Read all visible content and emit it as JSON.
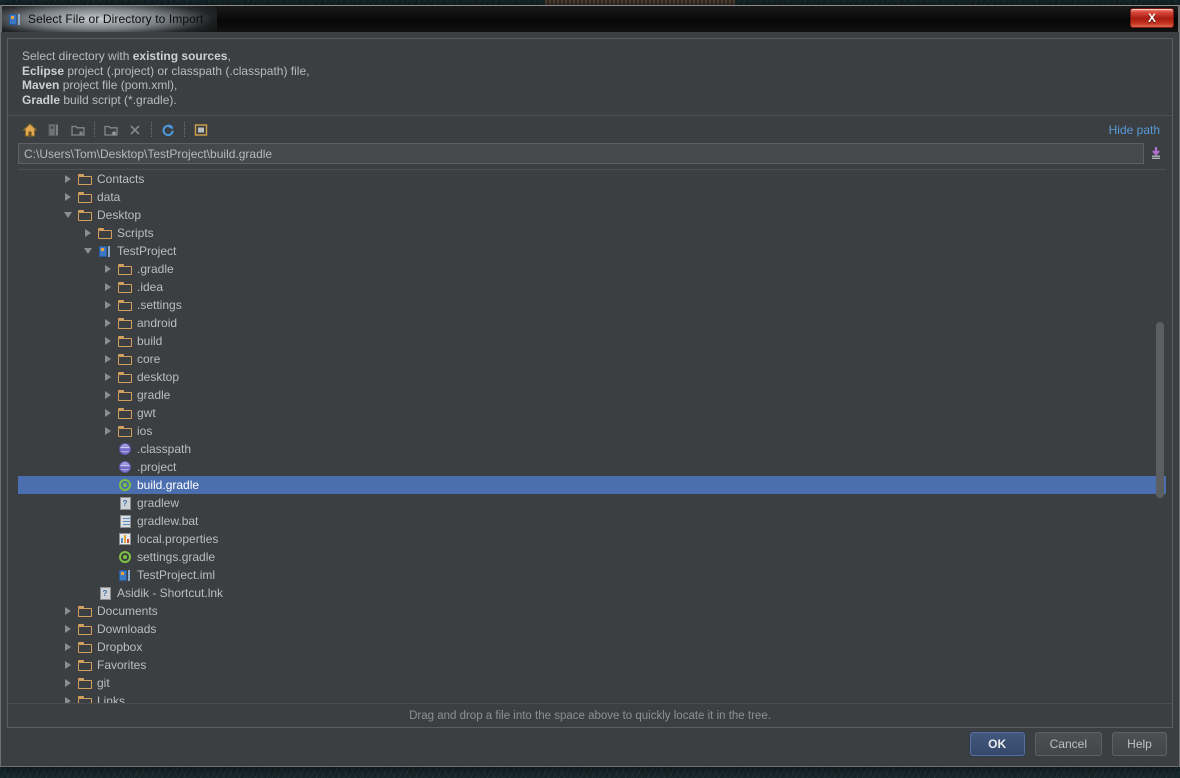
{
  "window": {
    "title": "Select File or Directory to Import",
    "app_icon": "intellij-idea-icon",
    "close_label": "X"
  },
  "description": {
    "line1_prefix": "Select directory with ",
    "line1_bold": "existing sources",
    "line1_suffix": ",",
    "line2_bold": "Eclipse",
    "line2_rest": " project (.project) or classpath (.classpath) file,",
    "line3_bold": "Maven",
    "line3_rest": " project file (pom.xml),",
    "line4_bold": "Gradle",
    "line4_rest": " build script (*.gradle)."
  },
  "toolbar": {
    "buttons": [
      {
        "name": "home-icon",
        "title": "Home"
      },
      {
        "name": "project-dir-icon",
        "title": "Project Directory"
      },
      {
        "name": "desktop-folder-icon",
        "title": "Desktop"
      },
      {
        "name": "new-folder-icon",
        "title": "New Folder"
      },
      {
        "name": "delete-icon",
        "title": "Delete"
      },
      {
        "name": "refresh-icon",
        "title": "Refresh"
      },
      {
        "name": "show-hidden-files-icon",
        "title": "Show Hidden Files and Directories"
      }
    ],
    "hide_path_label": "Hide path"
  },
  "path": {
    "value": "C:\\Users\\Tom\\Desktop\\TestProject\\build.gradle",
    "placeholder": "",
    "dropdown_icon": "path-history-dropdown-icon"
  },
  "tree": {
    "rows": [
      {
        "label": "Contacts",
        "indent": 1,
        "twisty": "collapsed",
        "icon": "folder"
      },
      {
        "label": "data",
        "indent": 1,
        "twisty": "collapsed",
        "icon": "folder"
      },
      {
        "label": "Desktop",
        "indent": 1,
        "twisty": "expanded",
        "icon": "folder"
      },
      {
        "label": "Scripts",
        "indent": 2,
        "twisty": "collapsed",
        "icon": "folder"
      },
      {
        "label": "TestProject",
        "indent": 2,
        "twisty": "expanded",
        "icon": "module"
      },
      {
        "label": ".gradle",
        "indent": 3,
        "twisty": "collapsed",
        "icon": "folder"
      },
      {
        "label": ".idea",
        "indent": 3,
        "twisty": "collapsed",
        "icon": "folder"
      },
      {
        "label": ".settings",
        "indent": 3,
        "twisty": "collapsed",
        "icon": "folder"
      },
      {
        "label": "android",
        "indent": 3,
        "twisty": "collapsed",
        "icon": "folder"
      },
      {
        "label": "build",
        "indent": 3,
        "twisty": "collapsed",
        "icon": "folder"
      },
      {
        "label": "core",
        "indent": 3,
        "twisty": "collapsed",
        "icon": "folder"
      },
      {
        "label": "desktop",
        "indent": 3,
        "twisty": "collapsed",
        "icon": "folder"
      },
      {
        "label": "gradle",
        "indent": 3,
        "twisty": "collapsed",
        "icon": "folder"
      },
      {
        "label": "gwt",
        "indent": 3,
        "twisty": "collapsed",
        "icon": "folder"
      },
      {
        "label": "ios",
        "indent": 3,
        "twisty": "collapsed",
        "icon": "folder"
      },
      {
        "label": ".classpath",
        "indent": 3,
        "twisty": "none",
        "icon": "sphere"
      },
      {
        "label": ".project",
        "indent": 3,
        "twisty": "none",
        "icon": "sphere"
      },
      {
        "label": "build.gradle",
        "indent": 3,
        "twisty": "none",
        "icon": "gradle",
        "selected": true
      },
      {
        "label": "gradlew",
        "indent": 3,
        "twisty": "none",
        "icon": "unknown"
      },
      {
        "label": "gradlew.bat",
        "indent": 3,
        "twisty": "none",
        "icon": "textfile"
      },
      {
        "label": "local.properties",
        "indent": 3,
        "twisty": "none",
        "icon": "props"
      },
      {
        "label": "settings.gradle",
        "indent": 3,
        "twisty": "none",
        "icon": "gradle"
      },
      {
        "label": "TestProject.iml",
        "indent": 3,
        "twisty": "none",
        "icon": "module"
      },
      {
        "label": "Asidik - Shortcut.lnk",
        "indent": 2,
        "twisty": "none",
        "icon": "unknown"
      },
      {
        "label": "Documents",
        "indent": 1,
        "twisty": "collapsed",
        "icon": "folder"
      },
      {
        "label": "Downloads",
        "indent": 1,
        "twisty": "collapsed",
        "icon": "folder"
      },
      {
        "label": "Dropbox",
        "indent": 1,
        "twisty": "collapsed",
        "icon": "folder"
      },
      {
        "label": "Favorites",
        "indent": 1,
        "twisty": "collapsed",
        "icon": "folder"
      },
      {
        "label": "git",
        "indent": 1,
        "twisty": "collapsed",
        "icon": "folder"
      },
      {
        "label": "Links",
        "indent": 1,
        "twisty": "collapsed",
        "icon": "folder"
      }
    ]
  },
  "hint": {
    "text": "Drag and drop a file into the space above to quickly locate it in the tree."
  },
  "buttons": {
    "ok": "OK",
    "cancel": "Cancel",
    "help": "Help"
  },
  "colors": {
    "selection": "#4b6eaf",
    "link": "#599ad8",
    "folder": "#d2a05c",
    "panel": "#3c3f41"
  }
}
